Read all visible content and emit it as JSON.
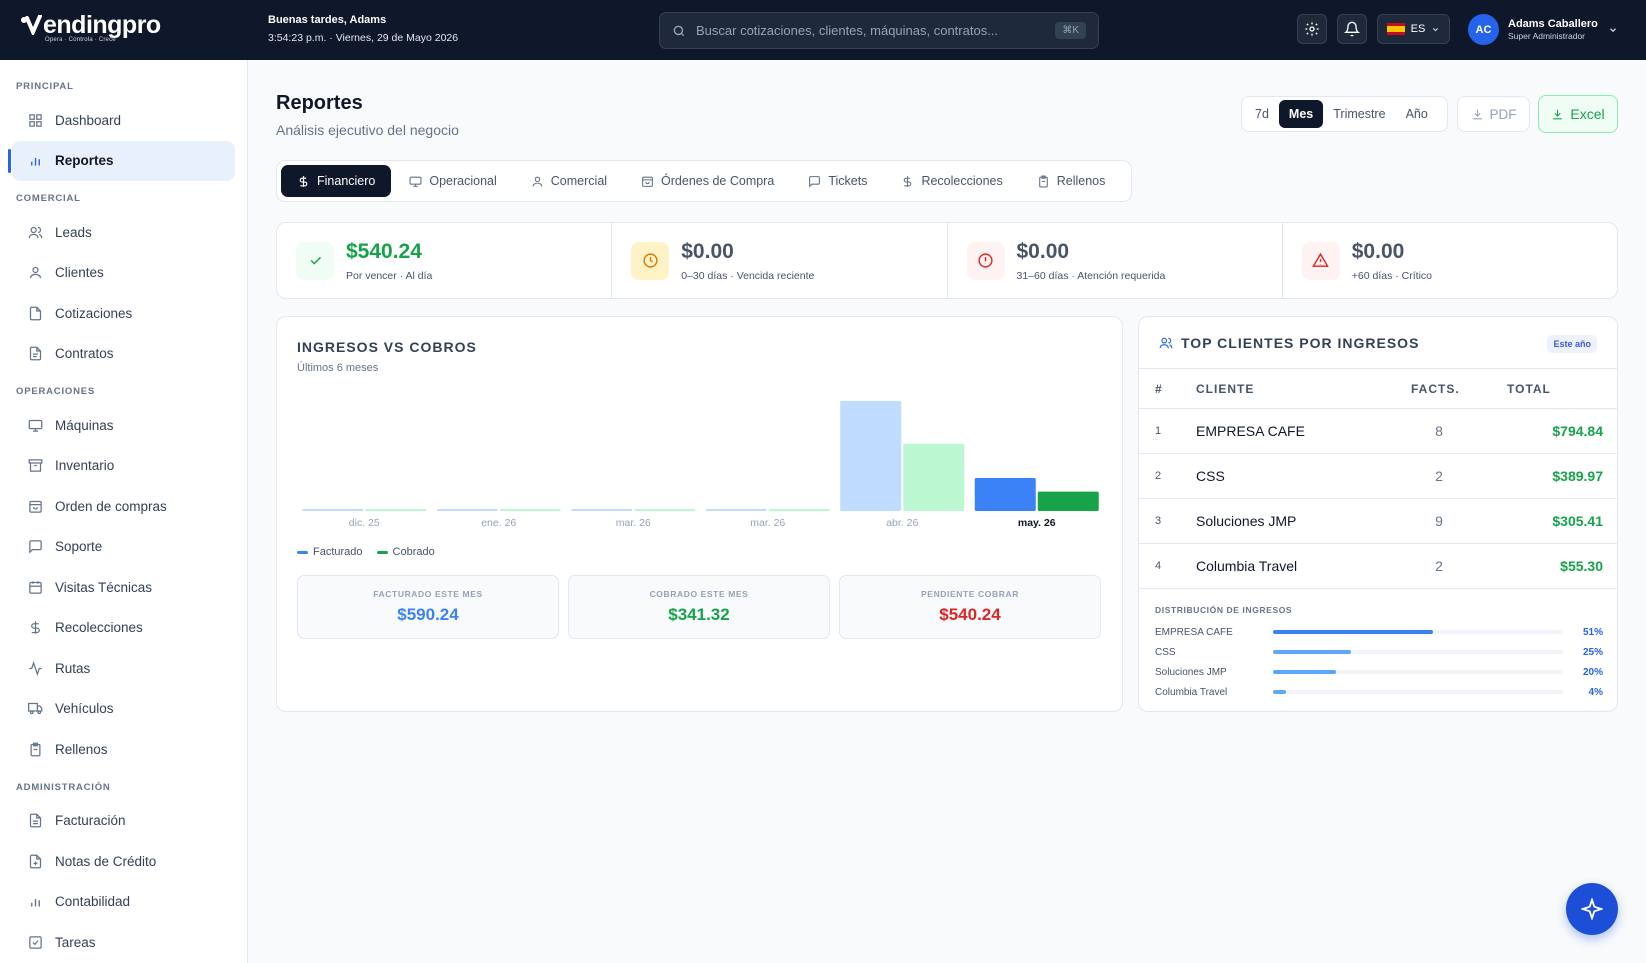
{
  "brand": {
    "name": "endingpro",
    "tagline": "Opera · Controla · Crece"
  },
  "header": {
    "greeting": "Buenas tardes, Adams",
    "datetime": "3:54:23 p.m. · Viernes, 29 de Mayo 2026",
    "search_placeholder": "Buscar cotizaciones, clientes, máquinas, contratos...",
    "search_shortcut": "⌘K",
    "language": "ES",
    "user_initials": "AC",
    "user_name": "Adams Caballero",
    "user_role": "Super Administrador"
  },
  "sidebar": {
    "principal_label": "PRINCIPAL",
    "principal": [
      "Dashboard",
      "Reportes"
    ],
    "comercial_label": "COMERCIAL",
    "comercial": [
      "Leads",
      "Clientes",
      "Cotizaciones",
      "Contratos"
    ],
    "operaciones_label": "OPERACIONES",
    "operaciones": [
      "Máquinas",
      "Inventario",
      "Orden de compras",
      "Soporte",
      "Visitas Técnicas",
      "Recolecciones",
      "Rutas",
      "Vehículos",
      "Rellenos"
    ],
    "administracion_label": "ADMINISTRACIÓN",
    "administracion": [
      "Facturación",
      "Notas de Crédito",
      "Contabilidad",
      "Tareas"
    ]
  },
  "page": {
    "title": "Reportes",
    "subtitle": "Análisis ejecutivo del negocio",
    "periods": [
      "7d",
      "Mes",
      "Trimestre",
      "Año"
    ],
    "pdf_label": "PDF",
    "excel_label": "Excel",
    "tabs": [
      "Financiero",
      "Operacional",
      "Comercial",
      "Órdenes de Compra",
      "Tickets",
      "Recolecciones",
      "Rellenos"
    ]
  },
  "kpis": [
    {
      "value": "$540.24",
      "label": "Por vencer · Al día",
      "color": "#16a34a"
    },
    {
      "value": "$0.00",
      "label": "0–30 días · Vencida reciente",
      "color": "#475569"
    },
    {
      "value": "$0.00",
      "label": "31–60 días · Atención requerida",
      "color": "#475569"
    },
    {
      "value": "$0.00",
      "label": "+60 días · Crítico",
      "color": "#475569"
    }
  ],
  "chart": {
    "title": "INGRESOS VS COBROS",
    "subtitle": "Últimos 6 meses",
    "legend_billed": "Facturado",
    "legend_collected": "Cobrado",
    "summary_billed_label": "FACTURADO ESTE MES",
    "summary_billed_value": "$590.24",
    "summary_collected_label": "COBRADO ESTE MES",
    "summary_collected_value": "$341.32",
    "summary_pending_label": "PENDIENTE COBRAR",
    "summary_pending_value": "$540.24"
  },
  "chart_data": {
    "type": "bar",
    "categories": [
      "dic. 25",
      "ene. 26",
      "mar. 26",
      "mar. 26",
      "abr. 26",
      "may. 26"
    ],
    "series": [
      {
        "name": "Facturado",
        "values": [
          0,
          0,
          0,
          0,
          1700,
          510
        ],
        "color": "#bfdbfe",
        "current_color": "#3b82f6"
      },
      {
        "name": "Cobrado",
        "values": [
          0,
          0,
          0,
          0,
          1040,
          300
        ],
        "color": "#bbf7d0",
        "current_color": "#16a34a"
      }
    ],
    "ylim": [
      0,
      1700
    ],
    "grid": false,
    "legend": "bottom-left"
  },
  "top_clients": {
    "title": "TOP CLIENTES POR INGRESOS",
    "badge": "Este año",
    "columns": [
      "#",
      "CLIENTE",
      "FACTS.",
      "TOTAL"
    ],
    "rows": [
      {
        "rank": "1",
        "name": "EMPRESA CAFE",
        "facts": "8",
        "total": "$794.84"
      },
      {
        "rank": "2",
        "name": "CSS",
        "facts": "2",
        "total": "$389.97"
      },
      {
        "rank": "3",
        "name": "Soluciones JMP",
        "facts": "9",
        "total": "$305.41"
      },
      {
        "rank": "4",
        "name": "Columbia Travel",
        "facts": "2",
        "total": "$55.30"
      }
    ],
    "dist_label": "DISTRIBUCIÓN DE INGRESOS",
    "distribution": [
      {
        "name": "EMPRESA CAFE",
        "pct": "51%",
        "fraction": 0.51
      },
      {
        "name": "CSS",
        "pct": "25%",
        "fraction": 0.25
      },
      {
        "name": "Soluciones JMP",
        "pct": "20%",
        "fraction": 0.2
      },
      {
        "name": "Columbia Travel",
        "pct": "4%",
        "fraction": 0.04
      }
    ]
  },
  "colors": {
    "navy": "#0f172a",
    "accent": "#2563eb",
    "green": "#16a34a",
    "red": "#dc2626"
  }
}
